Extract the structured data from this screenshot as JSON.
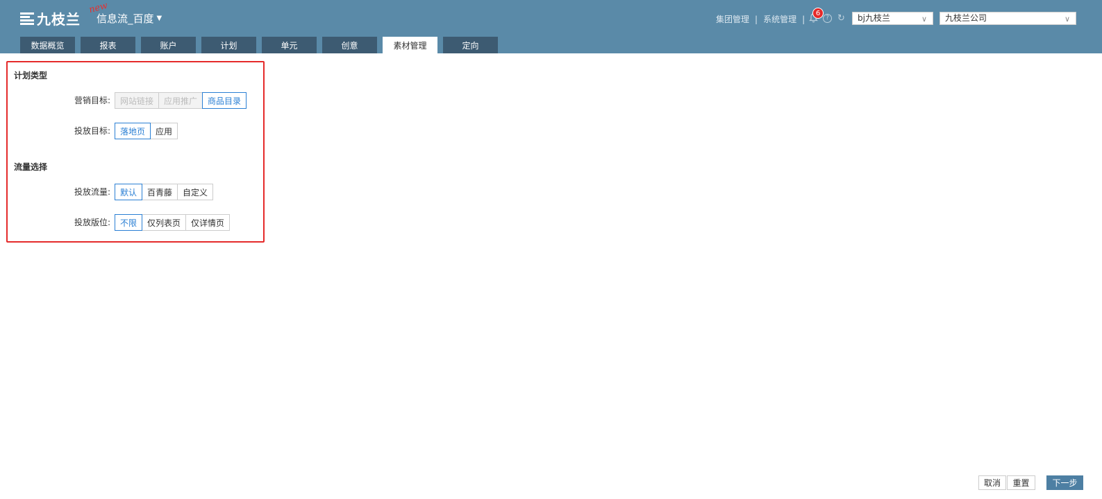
{
  "header": {
    "logo_text": "九枝兰",
    "new_badge": "new",
    "product_title": "信息流_百度",
    "links": [
      "集团管理",
      "系统管理"
    ],
    "notification_count": "6",
    "account_select": "bj九枝兰",
    "company_select": "九枝兰公司"
  },
  "tabs": [
    {
      "label": "数据概览"
    },
    {
      "label": "报表"
    },
    {
      "label": "账户"
    },
    {
      "label": "计划"
    },
    {
      "label": "单元"
    },
    {
      "label": "创意"
    },
    {
      "label": "素材管理",
      "active": true
    },
    {
      "label": "定向"
    }
  ],
  "form": {
    "plan_type": {
      "title": "计划类型",
      "marketing_goal": {
        "label": "营销目标:",
        "options": [
          "网站链接",
          "应用推广",
          "商品目录"
        ],
        "selected": "商品目录"
      },
      "delivery_goal": {
        "label": "投放目标:",
        "options": [
          "落地页",
          "应用"
        ],
        "selected": "落地页"
      }
    },
    "traffic": {
      "title": "流量选择",
      "delivery_traffic": {
        "label": "投放流量:",
        "options": [
          "默认",
          "百青藤",
          "自定义"
        ],
        "selected": "默认"
      },
      "delivery_position": {
        "label": "投放版位:",
        "options": [
          "不限",
          "仅列表页",
          "仅详情页"
        ],
        "selected": "不限"
      }
    }
  },
  "footer": {
    "cancel": "取消",
    "reset": "重置",
    "next": "下一步"
  },
  "colors": {
    "header_bg": "#5a8aa8",
    "tab_bg": "#3d5b72",
    "accent": "#2a7fd4",
    "highlight_border": "#e52a2a",
    "primary_button": "#4d7fa3"
  }
}
